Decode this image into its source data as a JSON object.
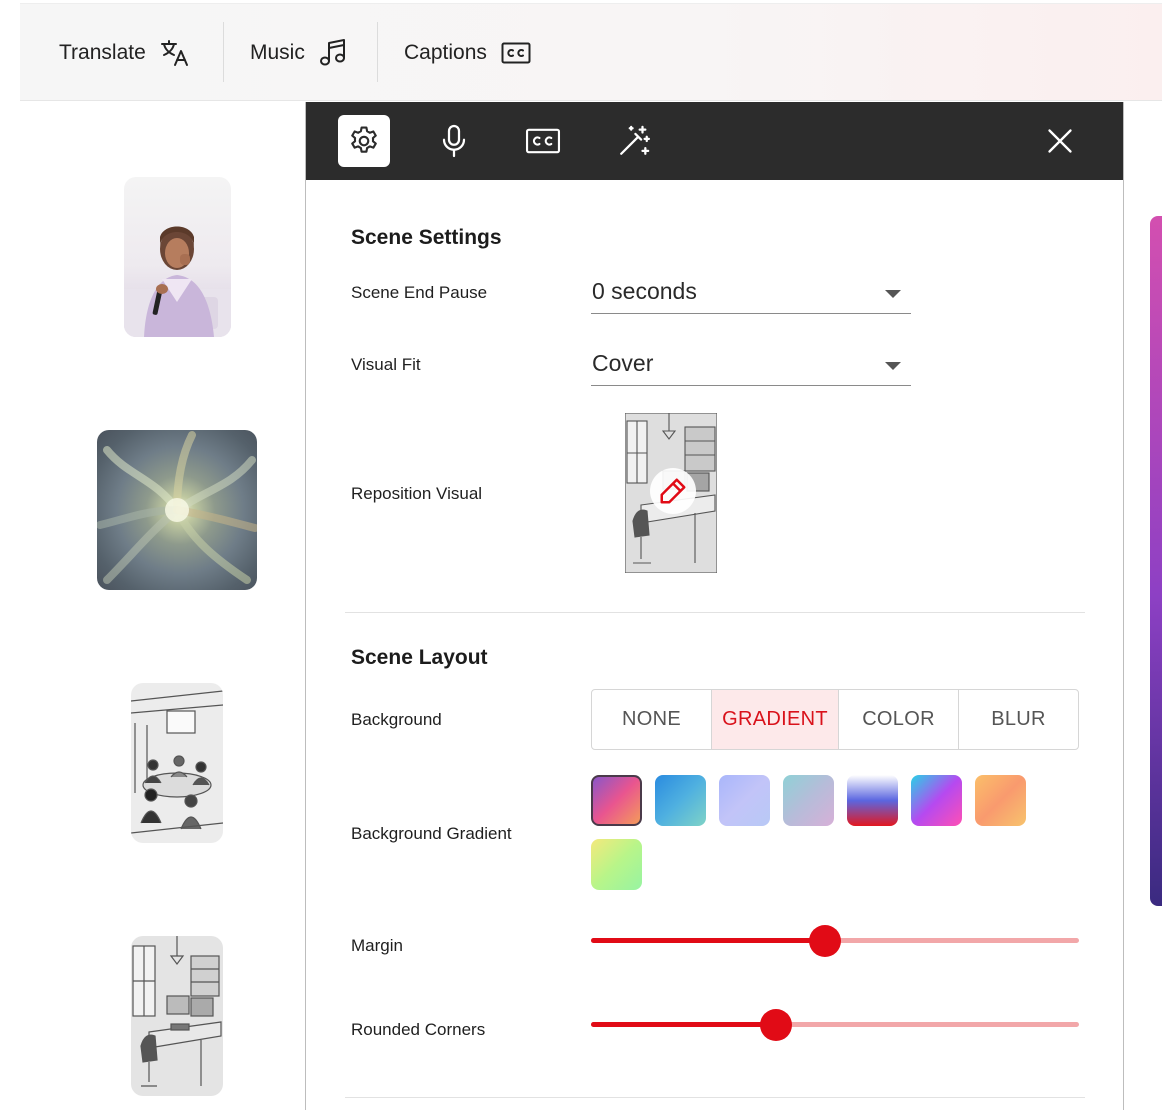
{
  "toolbar": {
    "items": [
      {
        "label": "Translate",
        "icon": "translate-icon"
      },
      {
        "label": "Music",
        "icon": "music-note-icon"
      },
      {
        "label": "Captions",
        "icon": "closed-captions-icon"
      }
    ]
  },
  "panel": {
    "tabs": [
      {
        "name": "settings",
        "icon": "gear-icon",
        "active": true
      },
      {
        "name": "voice",
        "icon": "microphone-icon",
        "active": false
      },
      {
        "name": "captions",
        "icon": "closed-captions-icon",
        "active": false
      },
      {
        "name": "effects",
        "icon": "magic-wand-icon",
        "active": false
      }
    ],
    "close_icon": "close-icon"
  },
  "scene_settings": {
    "title": "Scene Settings",
    "end_pause": {
      "label": "Scene End Pause",
      "value": "0 seconds"
    },
    "visual_fit": {
      "label": "Visual Fit",
      "value": "Cover"
    },
    "reposition": {
      "label": "Reposition Visual",
      "icon": "pencil-icon"
    }
  },
  "scene_layout": {
    "title": "Scene Layout",
    "background": {
      "label": "Background",
      "options": [
        "NONE",
        "GRADIENT",
        "COLOR",
        "BLUR"
      ],
      "selected": "GRADIENT"
    },
    "background_gradient": {
      "label": "Background Gradient",
      "selected_index": 0,
      "swatches": [
        [
          "#8a56c8",
          "#e9558f",
          "#f49b5a"
        ],
        [
          "#2a8be0",
          "#4fb0e0",
          "#7fd3c7"
        ],
        [
          "#a9b6fb",
          "#c2c4f8",
          "#b8c9f6"
        ],
        [
          "#8fd1d6",
          "#b6bcd9",
          "#d7b0d8"
        ],
        [
          "#ffffff",
          "#5b66e0",
          "#e3171f"
        ],
        [
          "#27d2e6",
          "#b54af0",
          "#ff4fb4"
        ],
        [
          "#fbbf6a",
          "#f99a6e",
          "#f7c36d"
        ],
        [
          "#f4e97c",
          "#b8f589",
          "#97f4a2"
        ]
      ]
    },
    "margin": {
      "label": "Margin",
      "value": 0.48
    },
    "rounded_corners": {
      "label": "Rounded Corners",
      "value": 0.38
    }
  },
  "colors": {
    "accent": "#e10b16",
    "accent_light": "#f2a7a9",
    "panel_header": "#2c2c2c"
  }
}
